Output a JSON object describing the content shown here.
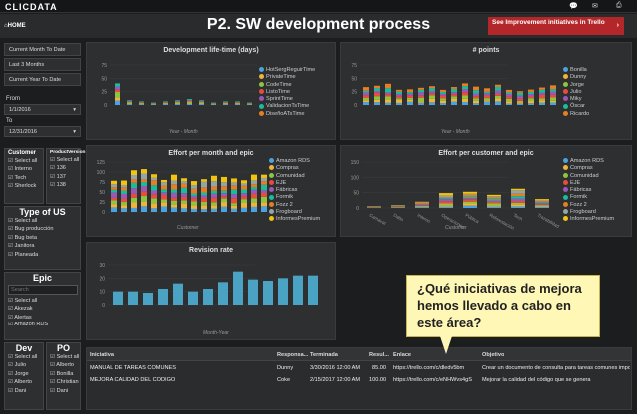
{
  "topbar": {
    "logo": "CLICDATA",
    "icons": [
      "chat-icon",
      "mail-icon",
      "print-icon"
    ]
  },
  "header": {
    "home": "⌂HOME",
    "title": "P2. SW development process",
    "cta": "See Improvement initiatives in Trello",
    "cta_arrow": "›"
  },
  "sidebar": {
    "buttons": [
      "Current Month To Date",
      "Last 3 Months",
      "Current Year To Date"
    ],
    "from_label": "From",
    "from_value": "1/1/2016",
    "to_label": "To",
    "to_value": "12/31/2016",
    "customer": {
      "header": "Customer",
      "items": [
        "Select all",
        "Interno",
        "Tech",
        "Sherlock"
      ]
    },
    "product": {
      "header": "ProductVersion",
      "items": [
        "Select all",
        "136",
        "137",
        "138"
      ]
    },
    "type": {
      "header": "Type of US",
      "items": [
        "Select all",
        "Bug producción",
        "Bug beta",
        "Janitora",
        "Planeada"
      ]
    },
    "epic": {
      "header": "Epic",
      "search_placeholder": "Search",
      "items": [
        "Select all",
        "Akezak",
        "Alertas",
        "Amazon RDS"
      ]
    },
    "dev": {
      "header": "Dev",
      "items": [
        "Select all",
        "Julio",
        "Jorge",
        "Alberto",
        "Dani"
      ]
    },
    "po": {
      "header": "PO",
      "items": [
        "Select all",
        "Alberto",
        "Bonilla",
        "Christian",
        "Dani"
      ]
    }
  },
  "panels": {
    "devtime": {
      "title": "Development life-time (days)",
      "xlabel": "Year - Month",
      "legend": [
        "HotSergReguirTime",
        "PrivateTime",
        "CodeTime",
        "ListoTime",
        "SprintTime",
        "ValidacionTsTime",
        "DiseñoATsTime"
      ],
      "yticks": [
        "0",
        "25",
        "50",
        "75"
      ]
    },
    "points": {
      "title": "# points",
      "xlabel": "Year - Month",
      "legend": [
        "Bonilla",
        "Dunny",
        "Jorge",
        "Julio",
        "Miky",
        "Óscar",
        "Ricardo"
      ],
      "yticks": [
        "0",
        "25",
        "50",
        "75"
      ]
    },
    "effort_month": {
      "title": "Effort per month and epic",
      "xlabel": "Customer",
      "legend": [
        "Amazon RDS",
        "Compras",
        "Comunidad",
        "EJE",
        "Fábricas",
        "Formik",
        "Fozz 2",
        "Frogboard",
        "InformesPremium"
      ],
      "yticks": [
        "0",
        "25",
        "50",
        "75",
        "100",
        "125"
      ]
    },
    "effort_customer": {
      "title": "Effort per customer and epic",
      "xlabel": "Customer",
      "legend": [
        "Amazon RDS",
        "Compras",
        "Comunidad",
        "EJE",
        "Fábricas",
        "Formik",
        "Fozz 2",
        "Frogboard",
        "InformesPremium"
      ],
      "xcats": [
        "Carnaval",
        "Dabo",
        "Interno",
        "Operaciones",
        "Pública",
        "Reforestación",
        "Tech",
        "Trazabilidad"
      ],
      "yticks": [
        "0",
        "50",
        "100",
        "150"
      ]
    },
    "revision": {
      "title": "Revision rate",
      "xlabel": "Month-Year",
      "yticks": [
        "0",
        "10",
        "20",
        "30"
      ],
      "values": [
        10,
        10,
        9,
        12,
        16,
        10,
        12,
        17,
        25,
        19,
        18,
        20,
        22,
        22
      ]
    }
  },
  "table": {
    "headers": [
      "Iniciativa",
      "Responsa...",
      "Terminada",
      "Resul...",
      "Enlace",
      "Objetivo"
    ],
    "rows": [
      [
        "MANUAL DE TAREAS COMUNES",
        "Dunny",
        "3/30/2016 12:00 AM",
        "85.00",
        "https://trello.com/c/dledv5bm",
        "Crear un documento de consulta para tareas comunes impo"
      ],
      [
        "MEJORA CALIDAD DEL CÓDIGO",
        "Coke",
        "2/15/2017 12:00 AM",
        "100.00",
        "https://trello.com/c/eNHWvs4gS",
        "Mejorar la calidad del código que se genera"
      ]
    ]
  },
  "callout": {
    "text": "¿Qué iniciativas de mejora hemos llevado a cabo en este área?"
  },
  "colors": {
    "accent": "#b3262a",
    "series": [
      "#4aa3df",
      "#f0b43c",
      "#8cc63e",
      "#e84c3d",
      "#9b59b6",
      "#1abc9c",
      "#e67e22",
      "#95a5a6",
      "#f1c40f"
    ]
  }
}
